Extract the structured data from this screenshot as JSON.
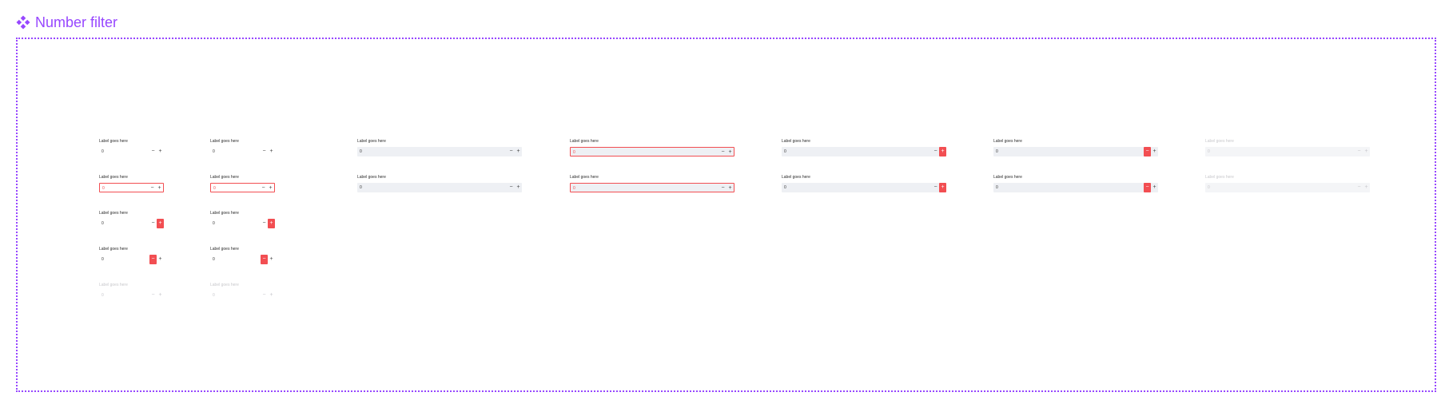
{
  "page_title": "Number filter",
  "title_icon": "component-diamond-icon",
  "accent_color": "#9747ff",
  "error_color": "#f24e52",
  "field": {
    "label": "Label goes here",
    "value": "0",
    "minus_glyph": "−",
    "plus_glyph": "+"
  }
}
